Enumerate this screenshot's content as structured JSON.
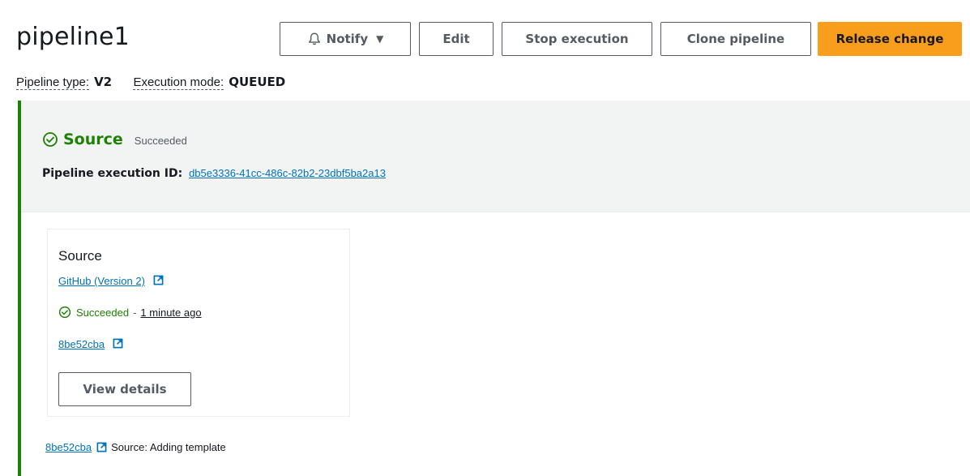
{
  "header": {
    "title": "pipeline1",
    "buttons": {
      "notify": "Notify",
      "edit": "Edit",
      "stop": "Stop execution",
      "clone": "Clone pipeline",
      "release": "Release change"
    }
  },
  "meta": {
    "pipeline_type_label": "Pipeline type:",
    "pipeline_type_value": "V2",
    "execution_mode_label": "Execution mode:",
    "execution_mode_value": "QUEUED"
  },
  "stage": {
    "name": "Source",
    "status": "Succeeded",
    "execution_id_label": "Pipeline execution ID:",
    "execution_id": "db5e3336-41cc-486c-82b2-23dbf5ba2a13"
  },
  "action": {
    "title": "Source",
    "provider": "GitHub (Version 2)",
    "status": "Succeeded",
    "separator": "-",
    "time": "1 minute ago",
    "commit": "8be52cba",
    "view_details": "View details"
  },
  "footer": {
    "commit": "8be52cba",
    "message": "Source: Adding template"
  },
  "colors": {
    "success": "#1d8102",
    "link": "#0073bb",
    "primary_button": "#f99d1c"
  },
  "icons": [
    "bell-icon",
    "caret-down-icon",
    "check-circle-icon",
    "external-link-icon"
  ]
}
